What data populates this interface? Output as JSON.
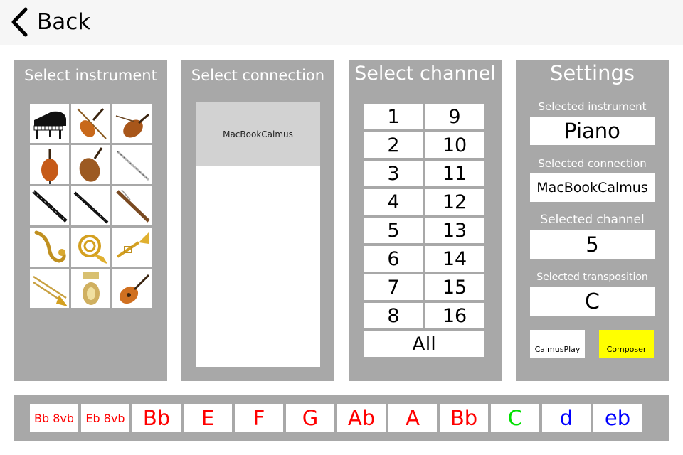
{
  "nav": {
    "back_label": "Back"
  },
  "instrument_panel": {
    "title": "Select instrument",
    "instruments": [
      {
        "name": "piano-icon"
      },
      {
        "name": "violin-bow-icon"
      },
      {
        "name": "viola-icon"
      },
      {
        "name": "cello-icon"
      },
      {
        "name": "double-bass-icon"
      },
      {
        "name": "flute-icon"
      },
      {
        "name": "oboe-icon"
      },
      {
        "name": "clarinet-icon"
      },
      {
        "name": "bassoon-icon"
      },
      {
        "name": "saxophone-icon"
      },
      {
        "name": "french-horn-icon"
      },
      {
        "name": "trumpet-icon"
      },
      {
        "name": "trombone-icon"
      },
      {
        "name": "tuba-icon"
      },
      {
        "name": "guitar-icon"
      }
    ]
  },
  "connection_panel": {
    "title": "Select connection",
    "connections": [
      "MacBookCalmus"
    ]
  },
  "channel_panel": {
    "title": "Select channel",
    "channels": [
      "1",
      "9",
      "2",
      "10",
      "3",
      "11",
      "4",
      "12",
      "5",
      "13",
      "6",
      "14",
      "7",
      "15",
      "8",
      "16"
    ],
    "all_label": "All"
  },
  "settings": {
    "title": "Settings",
    "instrument_label": "Selected instrument",
    "instrument_value": "Piano",
    "connection_label": "Selected connection",
    "connection_value": "MacBookCalmus",
    "channel_label": "Selected channel",
    "channel_value": "5",
    "transposition_label": "Selected transposition",
    "transposition_value": "C",
    "calmusplay_label": "CalmusPlay",
    "composer_label": "Composer",
    "composer_color": "#ffff00"
  },
  "transpositions": [
    {
      "label": "Bb 8vb",
      "color": "#ff0000"
    },
    {
      "label": "Eb 8vb",
      "color": "#ff0000"
    },
    {
      "label": "Bb",
      "color": "#ff0000"
    },
    {
      "label": "E",
      "color": "#ff0000"
    },
    {
      "label": "F",
      "color": "#ff0000"
    },
    {
      "label": "G",
      "color": "#ff0000"
    },
    {
      "label": "Ab",
      "color": "#ff0000"
    },
    {
      "label": "A",
      "color": "#ff0000"
    },
    {
      "label": "Bb",
      "color": "#ff0000"
    },
    {
      "label": "C",
      "color": "#00e000"
    },
    {
      "label": "d",
      "color": "#0000ff"
    },
    {
      "label": "eb",
      "color": "#0000ff"
    }
  ],
  "colors": {
    "panel": "#a8a8a8",
    "selected_connection": "#d2d2d2"
  }
}
